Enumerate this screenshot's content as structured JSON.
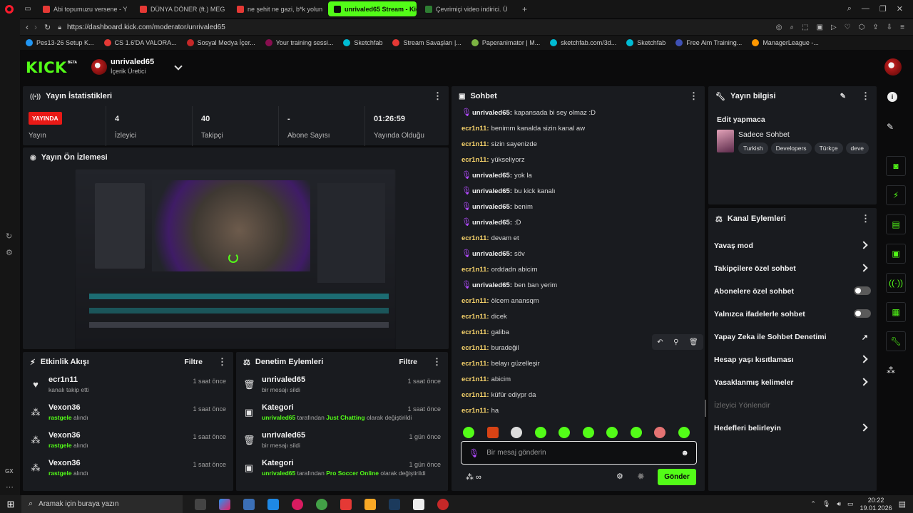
{
  "browser": {
    "tabs": [
      {
        "label": "Abi topumuzu versene - Y",
        "color": "#e53935"
      },
      {
        "label": "DÜNYA DÖNER (ft.) MEG",
        "color": "#e53935"
      },
      {
        "label": "ne şehit ne gazi, b*k yolun",
        "color": "#e53935"
      },
      {
        "label": "unrivaled65 Stream - Kick",
        "color": "#53fc18",
        "active": true
      },
      {
        "label": "Çevrimiçi video indirici. Ü",
        "color": "#2e7d32"
      }
    ],
    "url": "https://dashboard.kick.com/moderator/unrivaled65",
    "bookmarks": [
      "Pes13-26 Setup K...",
      "CS 1.6'DA VALORA...",
      "Sosyal Medya İçer...",
      "Your training sessi...",
      "Sketchfab",
      "Stream Savaşları |...",
      "Paperanimator | M...",
      "sketchfab.com/3d...",
      "Sketchfab",
      "Free Aim Training...",
      "ManagerLeague -..."
    ]
  },
  "header": {
    "logo": "KICK",
    "logo_badge": "BETA",
    "username": "unrivaled65",
    "role": "İçerik Üretici"
  },
  "stats": {
    "title": "Yayın İstatistikleri",
    "live_badge": "YAYINDA",
    "items": [
      {
        "label": "Yayın",
        "value": ""
      },
      {
        "label": "İzleyici",
        "value": "4"
      },
      {
        "label": "Takipçi",
        "value": "40"
      },
      {
        "label": "Abone Sayısı",
        "value": "-"
      },
      {
        "label": "Yayında Olduğu",
        "value": "01:26:59"
      }
    ]
  },
  "preview": {
    "title": "Yayın Ön İzlemesi"
  },
  "activity": {
    "title": "Etkinlik Akışı",
    "filter": "Filtre",
    "items": [
      {
        "user": "ecr1n11",
        "text": "kanalı takip etti",
        "time": "1 saat önce",
        "icon": "heart-icon"
      },
      {
        "user": "Vexon36",
        "hl": "rastgele",
        "text": " alındı",
        "time": "1 saat önce",
        "icon": "points-icon"
      },
      {
        "user": "Vexon36",
        "hl": "rastgele",
        "text": " alındı",
        "time": "1 saat önce",
        "icon": "points-icon"
      },
      {
        "user": "Vexon36",
        "hl": "rastgele",
        "text": " alındı",
        "time": "1 saat önce",
        "icon": "points-icon"
      }
    ]
  },
  "moderation": {
    "title": "Denetim Eylemleri",
    "filter": "Filtre",
    "items": [
      {
        "user": "unrivaled65",
        "text": "bir mesajı sildi",
        "time": "1 saat önce",
        "icon": "trash-icon"
      },
      {
        "user": "Kategori",
        "hl": "unrivaled65",
        "mid": " tarafından ",
        "hl2": "Just Chatting",
        "text": " olarak değiştirildi",
        "time": "1 saat önce",
        "icon": "category-icon"
      },
      {
        "user": "unrivaled65",
        "text": "bir mesajı sildi",
        "time": "1 gün önce",
        "icon": "trash-icon"
      },
      {
        "user": "Kategori",
        "hl": "unrivaled65",
        "mid": " tarafından ",
        "hl2": "Pro Soccer Online",
        "text": " olarak değiştirildi",
        "time": "1 gün önce",
        "icon": "category-icon"
      }
    ]
  },
  "chat": {
    "title": "Sohbet",
    "messages": [
      {
        "user": "unrivaled65",
        "text": "kapansada bi sey olmaz :D",
        "mod": true
      },
      {
        "user": "ecr1n11",
        "text": "benimm kanalda sizin kanal aw"
      },
      {
        "user": "ecr1n11",
        "text": "sizin sayenizde"
      },
      {
        "user": "ecr1n11",
        "text": "yükseliyorz"
      },
      {
        "user": "unrivaled65",
        "text": "yok la",
        "mod": true
      },
      {
        "user": "unrivaled65",
        "text": "bu kick kanalı",
        "mod": true
      },
      {
        "user": "unrivaled65",
        "text": "benim",
        "mod": true
      },
      {
        "user": "unrivaled65",
        "text": ":D",
        "mod": true
      },
      {
        "user": "ecr1n11",
        "text": "devam et"
      },
      {
        "user": "unrivaled65",
        "text": "söv",
        "mod": true
      },
      {
        "user": "ecr1n11",
        "text": "orddadn abicim"
      },
      {
        "user": "unrivaled65",
        "text": "ben ban yerim",
        "mod": true
      },
      {
        "user": "ecr1n11",
        "text": "ölcem anansqm"
      },
      {
        "user": "ecr1n11",
        "text": "dicek"
      },
      {
        "user": "ecr1n11",
        "text": "galiba"
      },
      {
        "user": "ecr1n11",
        "text": "buradeğil"
      },
      {
        "user": "ecr1n11",
        "text": "belayı güzelleşir"
      },
      {
        "user": "ecr1n11",
        "text": "abicim"
      },
      {
        "user": "ecr1n11",
        "text": "küfür ediypr da"
      },
      {
        "user": "ecr1n11",
        "text": "ha"
      }
    ],
    "placeholder": "Bir mesaj gönderin",
    "send": "Gönder"
  },
  "stream_info": {
    "title": "Yayın bilgisi",
    "stream_title": "Edit yapmaca",
    "category": "Sadece Sohbet",
    "tags": [
      "Turkish",
      "Developers",
      "Türkçe",
      "deve"
    ]
  },
  "channel_actions": {
    "title": "Kanal Eylemleri",
    "items": [
      {
        "label": "Yavaş mod",
        "control": "chevron"
      },
      {
        "label": "Takipçilere özel sohbet",
        "control": "chevron"
      },
      {
        "label": "Abonelere özel sohbet",
        "control": "toggle"
      },
      {
        "label": "Yalnızca ifadelerle sohbet",
        "control": "toggle"
      },
      {
        "label": "Yapay Zeka ile Sohbet Denetimi",
        "control": "external"
      },
      {
        "label": "Hesap yaşı kısıtlaması",
        "control": "chevron"
      },
      {
        "label": "Yasaklanmış kelimeler",
        "control": "chevron"
      },
      {
        "label": "İzleyici Yönlendir",
        "control": "disabled"
      },
      {
        "label": "Hedefleri belirleyin",
        "control": "chevron"
      }
    ]
  },
  "taskbar": {
    "search": "Aramak için buraya yazın",
    "time": "20:22",
    "date": "19.01.2026"
  }
}
